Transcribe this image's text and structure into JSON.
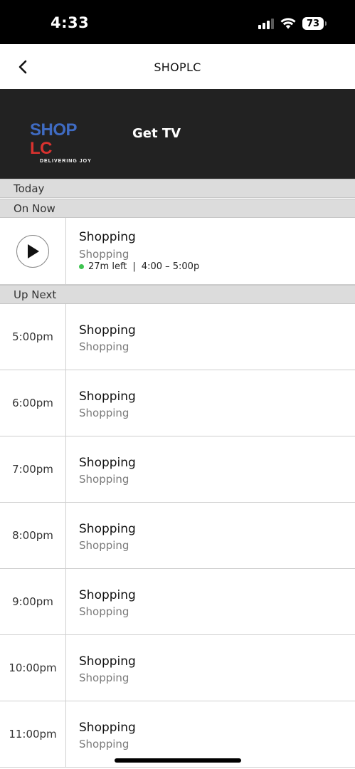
{
  "status_bar": {
    "time": "4:33",
    "battery": "73"
  },
  "nav": {
    "title": "SHOPLC"
  },
  "banner": {
    "logo_shop": "SHOP",
    "logo_lc": "LC",
    "logo_tagline": "DELIVERING JOY",
    "get_tv_label": "Get TV",
    "colors": {
      "background": "#222222",
      "shop": "#3f6bc2",
      "lc": "#d9322f"
    }
  },
  "sections": {
    "today": "Today",
    "on_now": "On Now",
    "up_next": "Up Next"
  },
  "on_now": {
    "title": "Shopping",
    "subtitle": "Shopping",
    "time_left": "27m left",
    "separator": "|",
    "time_range": "4:00 – 5:00p",
    "live_color": "#3ec450"
  },
  "up_next": [
    {
      "time": "5:00pm",
      "title": "Shopping",
      "subtitle": "Shopping"
    },
    {
      "time": "6:00pm",
      "title": "Shopping",
      "subtitle": "Shopping"
    },
    {
      "time": "7:00pm",
      "title": "Shopping",
      "subtitle": "Shopping"
    },
    {
      "time": "8:00pm",
      "title": "Shopping",
      "subtitle": "Shopping"
    },
    {
      "time": "9:00pm",
      "title": "Shopping",
      "subtitle": "Shopping"
    },
    {
      "time": "10:00pm",
      "title": "Shopping",
      "subtitle": "Shopping"
    },
    {
      "time": "11:00pm",
      "title": "Shopping",
      "subtitle": "Shopping"
    }
  ]
}
